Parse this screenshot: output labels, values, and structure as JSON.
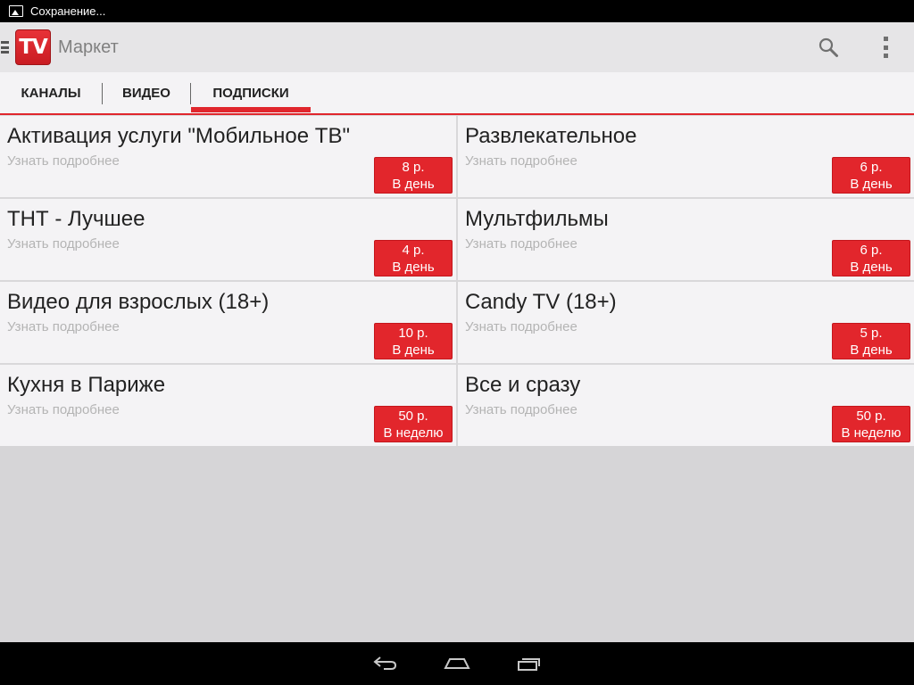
{
  "status_bar": {
    "text": "Сохранение..."
  },
  "action_bar": {
    "logo_text": "TV",
    "title": "Маркет"
  },
  "tabs": [
    {
      "label": "КАНАЛЫ"
    },
    {
      "label": "ВИДЕО"
    },
    {
      "label": "ПОДПИСКИ",
      "selected": true
    }
  ],
  "colors": {
    "accent": "#e2262c",
    "background": "#d6d5d7",
    "card": "#f4f3f5"
  },
  "subscriptions": [
    {
      "title": "Активация услуги \"Мобильное ТВ\"",
      "subtitle": "Узнать подробнее",
      "price": "8 р.",
      "period": "В день"
    },
    {
      "title": "Развлекательное",
      "subtitle": "Узнать подробнее",
      "price": "6 р.",
      "period": "В день"
    },
    {
      "title": "ТНТ - Лучшее",
      "subtitle": "Узнать подробнее",
      "price": "4 р.",
      "period": "В день"
    },
    {
      "title": "Мультфильмы",
      "subtitle": "Узнать подробнее",
      "price": "6 р.",
      "period": "В день"
    },
    {
      "title": "Видео для взрослых (18+)",
      "subtitle": "Узнать подробнее",
      "price": "10 р.",
      "period": "В день"
    },
    {
      "title": "Candy TV (18+)",
      "subtitle": "Узнать подробнее",
      "price": "5 р.",
      "period": "В день"
    },
    {
      "title": "Кухня в Париже",
      "subtitle": "Узнать подробнее",
      "price": "50 р.",
      "period": "В неделю"
    },
    {
      "title": "Все и сразу",
      "subtitle": "Узнать подробнее",
      "price": "50 р.",
      "period": "В неделю"
    }
  ],
  "icons": {
    "status": "image-icon",
    "drawer": "drawer-menu-icon",
    "search": "search-icon",
    "overflow": "overflow-menu-icon",
    "back": "back-icon",
    "home": "home-icon",
    "recents": "recent-apps-icon"
  }
}
